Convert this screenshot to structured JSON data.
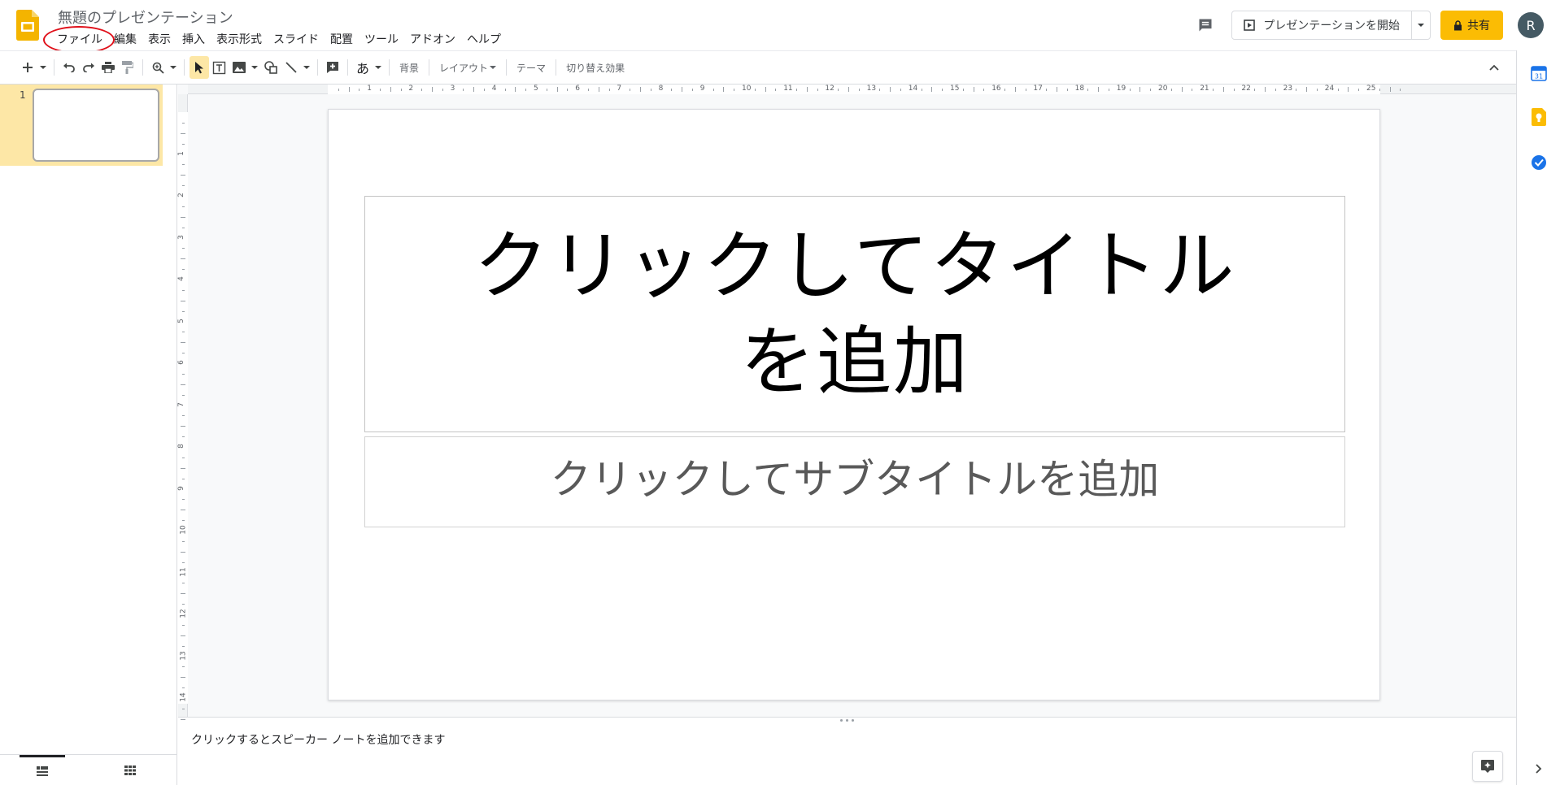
{
  "header": {
    "doc_title": "無題のプレゼンテーション",
    "menu": [
      "ファイル",
      "編集",
      "表示",
      "挿入",
      "表示形式",
      "スライド",
      "配置",
      "ツール",
      "アドオン",
      "ヘルプ"
    ],
    "present_label": "プレゼンテーションを開始",
    "share_label": "共有",
    "avatar_letter": "R",
    "brand_color": "#fbbc04"
  },
  "toolbar": {
    "background_label": "背景",
    "layout_label": "レイアウト",
    "theme_label": "テーマ",
    "transition_label": "切り替え効果",
    "input_tools_label": "あ",
    "icons": [
      "plus-icon",
      "undo-icon",
      "redo-icon",
      "print-icon",
      "paint-format-icon",
      "zoom-icon",
      "select-icon",
      "textbox-icon",
      "image-icon",
      "shape-icon",
      "line-icon",
      "new-comment-icon",
      "input-tools-icon"
    ]
  },
  "filmstrip": {
    "slides": [
      {
        "number": "1"
      }
    ]
  },
  "rulers": {
    "horizontal": [
      "1",
      "2",
      "3",
      "4",
      "5",
      "6",
      "7",
      "8",
      "9",
      "10",
      "11",
      "12",
      "13",
      "14",
      "15",
      "16",
      "17",
      "18",
      "19",
      "20",
      "21",
      "22",
      "23",
      "24",
      "25"
    ],
    "vertical": [
      "1",
      "2",
      "3",
      "4",
      "5",
      "6",
      "7",
      "8",
      "9",
      "10",
      "11",
      "12",
      "13",
      "14"
    ]
  },
  "slide": {
    "title_placeholder": "クリックしてタイトルを追加",
    "subtitle_placeholder": "クリックしてサブタイトルを追加"
  },
  "notes": {
    "placeholder": "クリックするとスピーカー ノートを追加できます"
  },
  "sidepanel": {
    "calendar_day": "31",
    "icons": [
      "calendar-icon",
      "keep-icon",
      "tasks-icon"
    ]
  }
}
